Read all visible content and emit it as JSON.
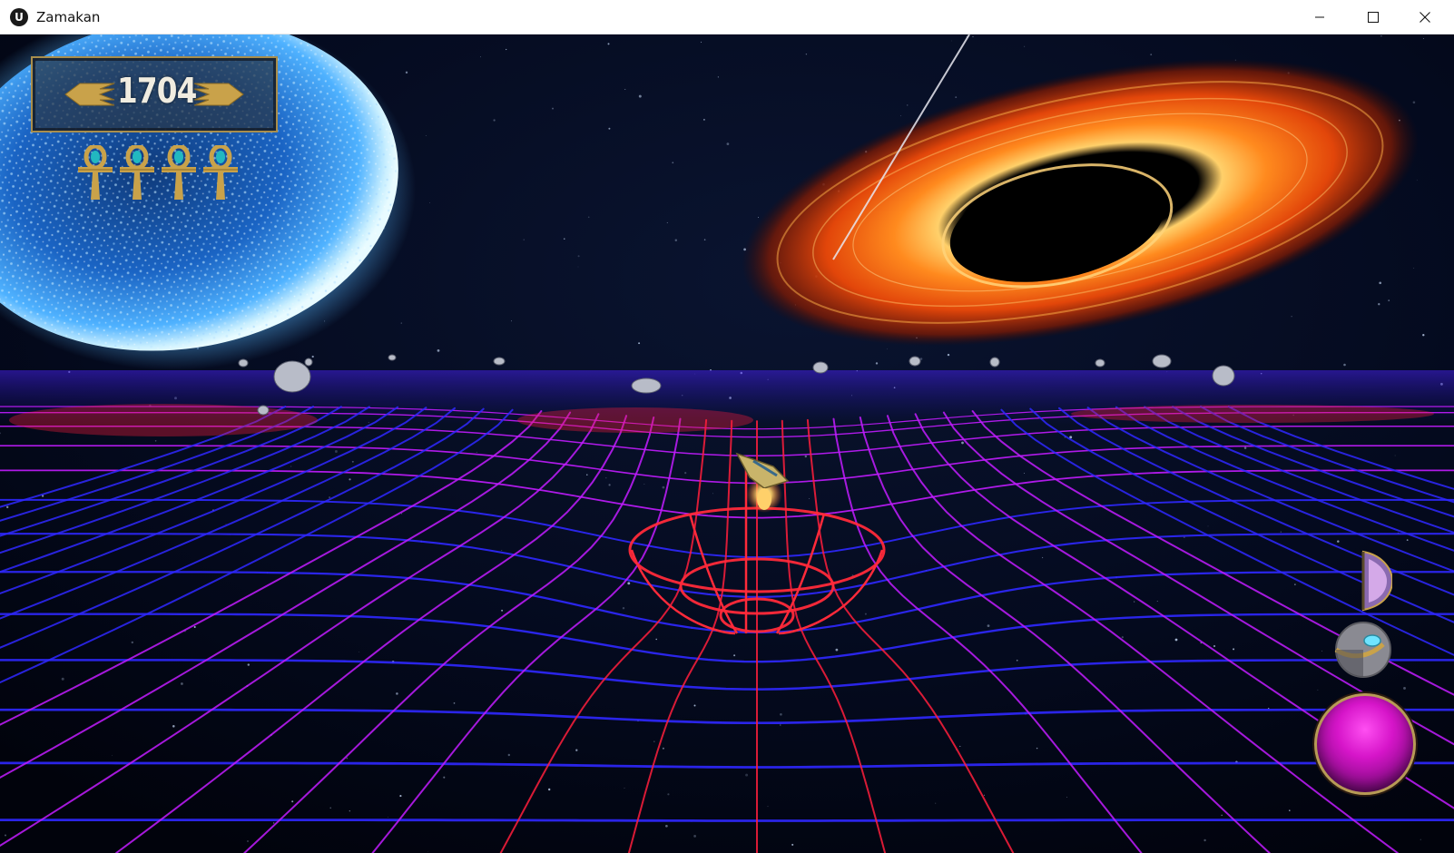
{
  "window": {
    "title": "Zamakan",
    "logo_glyph": "U"
  },
  "titlebar_controls": {
    "minimize_icon": "minimize-icon",
    "maximize_icon": "maximize-icon",
    "close_icon": "close-icon"
  },
  "hud": {
    "score": "1704",
    "lives": 4,
    "lives_icon": "ankh-icon",
    "abilities": [
      {
        "name": "shield-ability-icon"
      },
      {
        "name": "boost-ability-icon"
      }
    ],
    "fire_button_icon": "fire-orb-icon"
  },
  "colors": {
    "grid_blue": "#2f28ff",
    "grid_magenta": "#c21cff",
    "grid_red": "#ff1e3c",
    "star_blue": "#3aa8ff",
    "accretion_orange": "#ff7a1a",
    "hud_gold": "#c9a24a",
    "fire_magenta": "#e61ad8"
  }
}
